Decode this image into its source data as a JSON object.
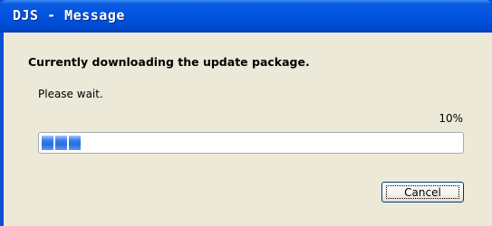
{
  "window": {
    "title": "DJS - Message"
  },
  "message": {
    "heading": "Currently downloading the update package.",
    "status": "Please wait."
  },
  "progress": {
    "percent_label": "10%",
    "value": 0.1,
    "fill_color": "#3d82ef"
  },
  "buttons": {
    "cancel_label": "Cancel"
  }
}
